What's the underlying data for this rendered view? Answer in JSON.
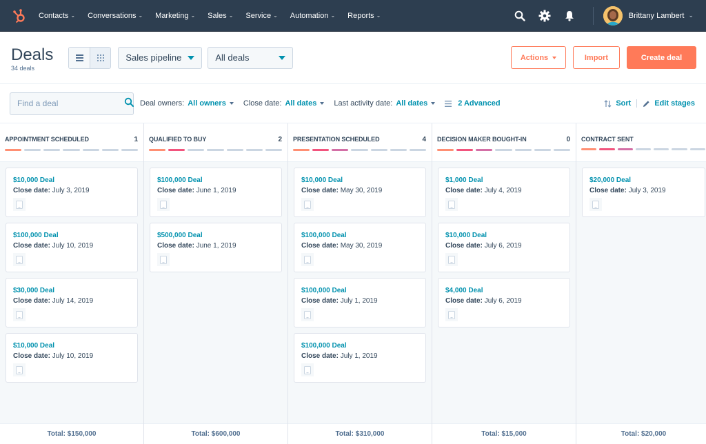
{
  "topnav": {
    "logo_icon": "hubspot-sprocket-icon",
    "items": [
      {
        "label": "Contacts"
      },
      {
        "label": "Conversations"
      },
      {
        "label": "Marketing"
      },
      {
        "label": "Sales"
      },
      {
        "label": "Service"
      },
      {
        "label": "Automation"
      },
      {
        "label": "Reports"
      }
    ],
    "icons": [
      "search-icon",
      "gear-icon",
      "bell-icon"
    ],
    "user_name": "Brittany Lambert",
    "brand_color": "#ff7a59",
    "nav_bg": "#2d3e50"
  },
  "header": {
    "title": "Deals",
    "subtitle": "34 deals",
    "view_toggle": [
      "list-view-icon",
      "board-view-icon"
    ],
    "pipeline_select": "Sales pipeline",
    "deals_select": "All deals",
    "actions_label": "Actions",
    "import_label": "Import",
    "create_label": "Create deal"
  },
  "filters": {
    "search_placeholder": "Find a deal",
    "deal_owners_label": "Deal owners:",
    "deal_owners_value": "All owners",
    "close_date_label": "Close date:",
    "close_date_value": "All dates",
    "last_activity_label": "Last activity date:",
    "last_activity_value": "All dates",
    "advanced_label": "2 Advanced",
    "sort_label": "Sort",
    "edit_stages_label": "Edit stages"
  },
  "colors": {
    "accent": "#0091ae",
    "stage_bar_inactive": "#cbd6e2",
    "stage_bar_active": [
      "#ff8f73",
      "#f2547d",
      "#d36fa6"
    ]
  },
  "columns": [
    {
      "title": "APPOINTMENT SCHEDULED",
      "count": "1",
      "active_bars": 1,
      "cards": [
        {
          "name": "$10,000 Deal",
          "date_label": "Close date:",
          "date": "July 3, 2019"
        },
        {
          "name": "$100,000 Deal",
          "date_label": "Close date:",
          "date": "July 10, 2019"
        },
        {
          "name": "$30,000 Deal",
          "date_label": "Close date:",
          "date": "July 14, 2019"
        },
        {
          "name": "$10,000 Deal",
          "date_label": "Close date:",
          "date": "July 10, 2019"
        }
      ],
      "total": "Total: $150,000"
    },
    {
      "title": "QUALIFIED TO BUY",
      "count": "2",
      "active_bars": 2,
      "cards": [
        {
          "name": "$100,000 Deal",
          "date_label": "Close date:",
          "date": "June 1, 2019"
        },
        {
          "name": "$500,000 Deal",
          "date_label": "Close date:",
          "date": "June 1, 2019"
        }
      ],
      "total": "Total: $600,000"
    },
    {
      "title": "PRESENTATION SCHEDULED",
      "count": "4",
      "active_bars": 3,
      "cards": [
        {
          "name": "$10,000 Deal",
          "date_label": "Close date:",
          "date": "May 30, 2019"
        },
        {
          "name": "$100,000 Deal",
          "date_label": "Close date:",
          "date": "May 30, 2019"
        },
        {
          "name": "$100,000 Deal",
          "date_label": "Close date:",
          "date": "July 1, 2019"
        },
        {
          "name": "$100,000 Deal",
          "date_label": "Close date:",
          "date": "July 1, 2019"
        }
      ],
      "total": "Total: $310,000"
    },
    {
      "title": "DECISION MAKER BOUGHT-IN",
      "count": "0",
      "active_bars": 3,
      "cards": [
        {
          "name": "$1,000 Deal",
          "date_label": "Close date:",
          "date": "July 4, 2019"
        },
        {
          "name": "$10,000 Deal",
          "date_label": "Close date:",
          "date": "July 6, 2019"
        },
        {
          "name": "$4,000 Deal",
          "date_label": "Close date:",
          "date": "July 6, 2019"
        }
      ],
      "total": "Total: $15,000"
    },
    {
      "title": "CONTRACT SENT",
      "count": "",
      "active_bars": 3,
      "cards": [
        {
          "name": "$20,000 Deal",
          "date_label": "Close date:",
          "date": "July 3, 2019"
        }
      ],
      "total": "Total: $20,000"
    }
  ]
}
